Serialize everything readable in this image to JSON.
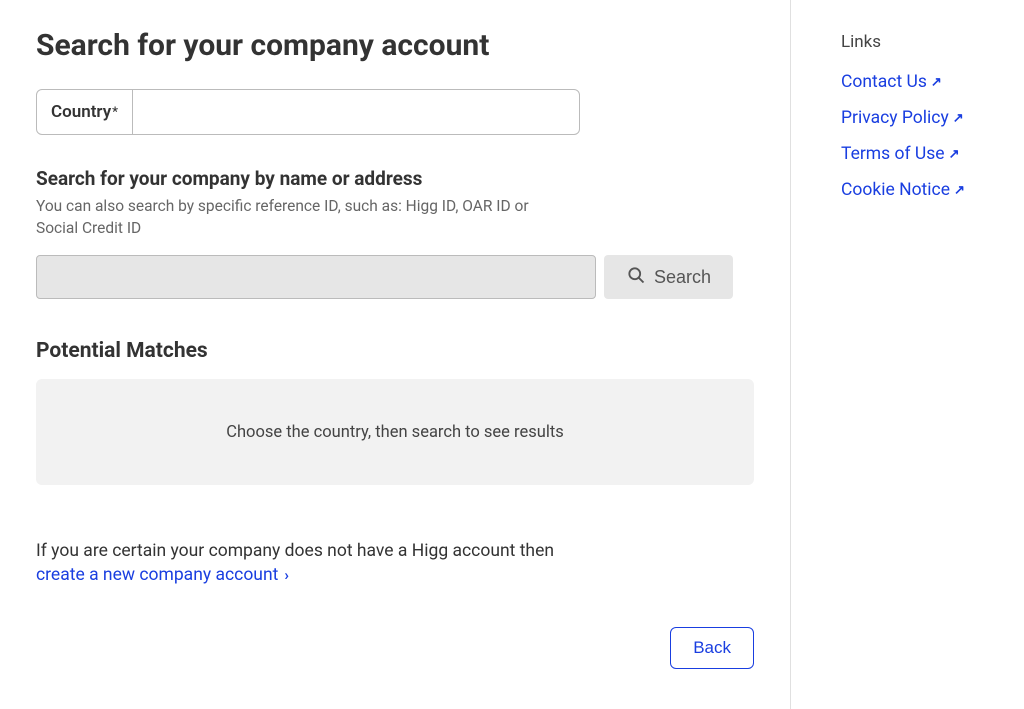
{
  "page": {
    "title": "Search for your company account",
    "country_label": "Country",
    "required_mark": "*",
    "search_heading": "Search for your company by name or address",
    "search_helper": "You can also search by specific reference ID, such as: Higg ID, OAR ID or Social Credit ID",
    "search_button": "Search",
    "matches_heading": "Potential Matches",
    "matches_placeholder": "Choose the country, then search to see results",
    "certain_text": "If you are certain your company does not have a Higg account then",
    "create_link": "create a new company account",
    "back_button": "Back"
  },
  "sidebar": {
    "heading": "Links",
    "items": [
      {
        "label": "Contact Us"
      },
      {
        "label": "Privacy Policy"
      },
      {
        "label": "Terms of Use"
      },
      {
        "label": "Cookie Notice"
      }
    ]
  }
}
